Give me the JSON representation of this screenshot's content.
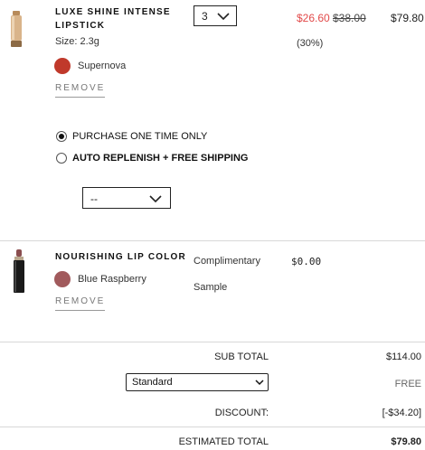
{
  "cart": {
    "items": [
      {
        "name_line1": "LUXE SHINE INTENSE",
        "name_line2": "LIPSTICK",
        "size": "Size: 2.3g",
        "shade": "Supernova",
        "shade_color": "#c0392b",
        "remove_label": "REMOVE",
        "quantity": "3",
        "sale_price": "$26.60",
        "original_price": "$38.00",
        "line_total": "$79.80",
        "discount_pct": "(30%)",
        "purchase_options": [
          {
            "label": "PURCHASE ONE TIME ONLY",
            "selected": true
          },
          {
            "label": "AUTO REPLENISH + FREE SHIPPING",
            "selected": false
          }
        ],
        "replenish_frequency": "--"
      },
      {
        "name": "NOURISHING LIP COLOR",
        "shade": "Blue Raspberry",
        "shade_color": "#a15a5c",
        "remove_label": "REMOVE",
        "complimentary_line1": "Complimentary",
        "complimentary_line2": "Sample",
        "price": "$0.00"
      }
    ]
  },
  "summary": {
    "subtotal_label": "SUB TOTAL",
    "subtotal_value": "$114.00",
    "shipping_method": "Standard",
    "shipping_value": "FREE",
    "discount_label": "DISCOUNT:",
    "discount_value": "[-$34.20]",
    "estimated_total_label": "ESTIMATED TOTAL",
    "estimated_total_value": "$79.80"
  },
  "colors": {
    "sale_red": "#e24a4a",
    "divider": "#d8d8d8"
  },
  "icons": {
    "chevron": "chevron-down-icon",
    "select_arrow": "select-arrow-icon"
  }
}
